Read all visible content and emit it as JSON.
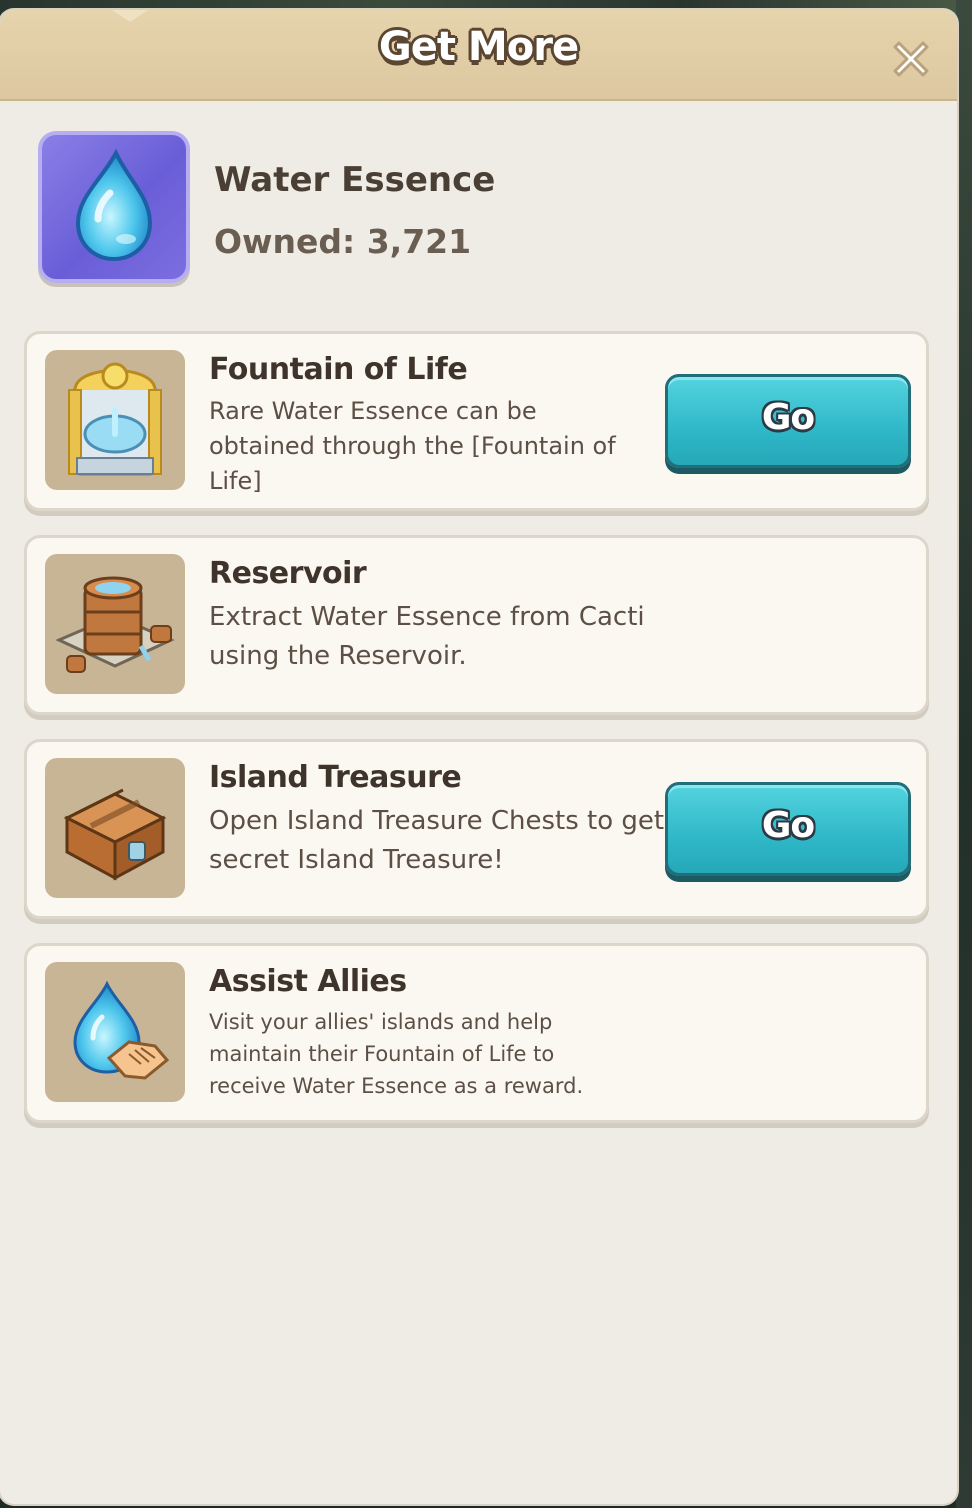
{
  "dialog": {
    "title": "Get More",
    "close_icon": "close-x-icon"
  },
  "item": {
    "name": "Water Essence",
    "owned": "Owned: 3,721",
    "icon": "water-drop-icon",
    "icon_bg_color": "#7265dc"
  },
  "sources": [
    {
      "title": "Fountain of Life",
      "description": "Rare Water Essence can be obtained through the [Fountain of Life]",
      "icon": "fountain-icon",
      "has_go": true,
      "go_label": "Go"
    },
    {
      "title": "Reservoir",
      "description": "Extract Water Essence from Cacti using the Reservoir.",
      "icon": "reservoir-icon",
      "has_go": false
    },
    {
      "title": "Island Treasure",
      "description": "Open Island Treasure Chests to get secret Island Treasure!",
      "icon": "treasure-chest-icon",
      "has_go": true,
      "go_label": "Go"
    },
    {
      "title": "Assist Allies",
      "description": "Visit your allies' islands and help maintain their Fountain of Life to receive Water Essence as a reward.",
      "icon": "water-handshake-icon",
      "has_go": false
    }
  ],
  "colors": {
    "header": "#dfc9a2",
    "panel": "#efece6",
    "card": "#fbf7f1",
    "go_button": "#2fb8c8"
  }
}
